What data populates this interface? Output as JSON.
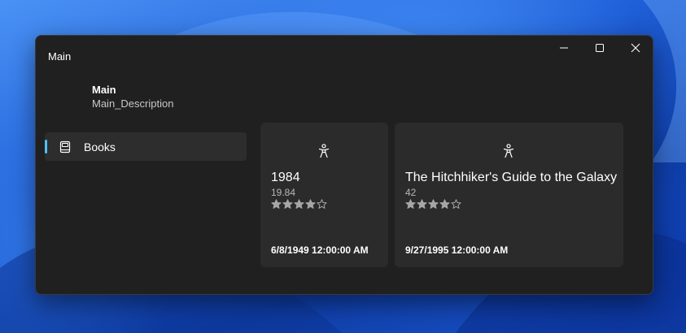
{
  "window": {
    "title": "Main"
  },
  "header": {
    "title": "Main",
    "description": "Main_Description"
  },
  "navigation": {
    "items": [
      {
        "label": "Books",
        "icon": "book-icon",
        "selected": true
      }
    ]
  },
  "books": [
    {
      "title": "1984",
      "value": "19.84",
      "rating": 4,
      "max_rating": 5,
      "date": "6/8/1949 12:00:00 AM",
      "icon": "accessibility-icon"
    },
    {
      "title": "The Hitchhiker's Guide to the Galaxy",
      "value": "42",
      "rating": 4,
      "max_rating": 5,
      "date": "9/27/1995 12:00:00 AM",
      "icon": "accessibility-icon"
    }
  ],
  "colors": {
    "window_bg": "#202020",
    "card_bg": "#2b2b2b",
    "nav_selected_bg": "#2d2d2d",
    "accent": "#4cc2ff",
    "star": "#a6a6a6"
  }
}
